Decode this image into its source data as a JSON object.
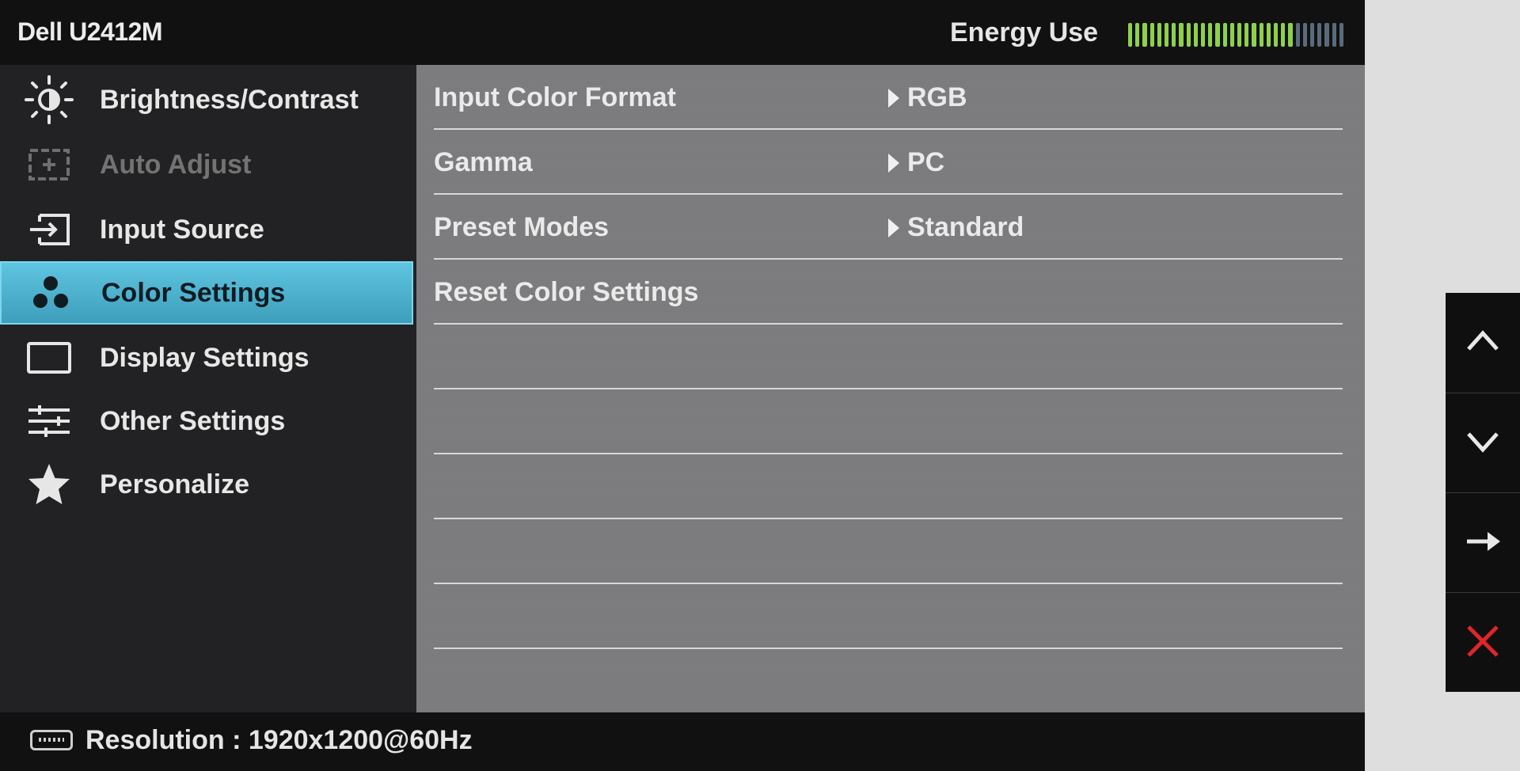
{
  "header": {
    "model": "Dell U2412M",
    "energy_label": "Energy Use",
    "energy_level": 0.75,
    "energy_segments": 30,
    "energy_active_color": "#8fd04a",
    "energy_inactive_color": "#5a6a7a"
  },
  "sidebar": {
    "items": [
      {
        "label": "Brightness/Contrast",
        "icon": "brightness-icon",
        "state": "normal"
      },
      {
        "label": "Auto Adjust",
        "icon": "auto-adjust-icon",
        "state": "disabled"
      },
      {
        "label": "Input Source",
        "icon": "input-source-icon",
        "state": "normal"
      },
      {
        "label": "Color Settings",
        "icon": "color-settings-icon",
        "state": "selected"
      },
      {
        "label": "Display Settings",
        "icon": "display-settings-icon",
        "state": "normal"
      },
      {
        "label": "Other Settings",
        "icon": "other-settings-icon",
        "state": "normal"
      },
      {
        "label": "Personalize",
        "icon": "star-icon",
        "state": "normal"
      }
    ]
  },
  "content": {
    "rows": [
      {
        "label": "Input Color Format",
        "value": "RGB"
      },
      {
        "label": "Gamma",
        "value": "PC"
      },
      {
        "label": "Preset Modes",
        "value": "Standard"
      },
      {
        "label": "Reset Color Settings",
        "value": ""
      },
      {
        "label": "",
        "value": ""
      },
      {
        "label": "",
        "value": ""
      },
      {
        "label": "",
        "value": ""
      },
      {
        "label": "",
        "value": ""
      },
      {
        "label": "",
        "value": ""
      }
    ]
  },
  "footer": {
    "resolution_text": "Resolution : 1920x1200@60Hz",
    "icon": "displayport-icon"
  },
  "buttons": [
    {
      "icon": "up-arrow-icon"
    },
    {
      "icon": "down-arrow-icon"
    },
    {
      "icon": "right-arrow-icon"
    },
    {
      "icon": "exit-x-icon",
      "color": "#e0262b"
    }
  ]
}
